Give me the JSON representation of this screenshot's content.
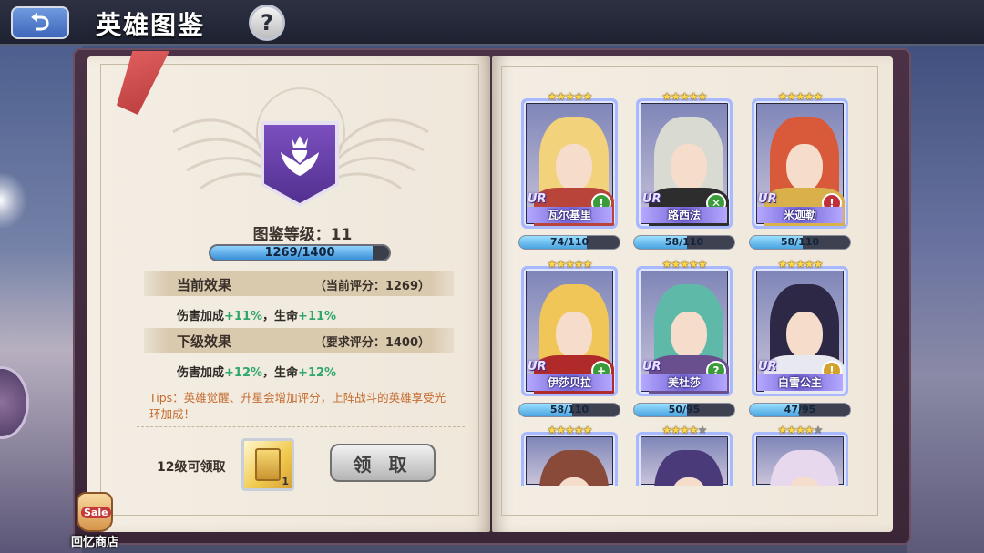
{
  "header": {
    "back_glyph": "⮌",
    "title": "英雄图鉴",
    "help_glyph": "?"
  },
  "codex": {
    "level_text": "图鉴等级：11",
    "progress_text": "1269/1400",
    "progress_fraction": 0.906,
    "current": {
      "title": "当前效果",
      "note": "（当前评分：1269）",
      "effect_prefix": "伤害加成",
      "effect_value1": "+11%",
      "effect_mid": "，生命",
      "effect_value2": "+11%"
    },
    "next": {
      "title": "下级效果",
      "note": "（要求评分：1400）",
      "effect_prefix": "伤害加成",
      "effect_value1": "+12%",
      "effect_mid": "，生命",
      "effect_value2": "+12%"
    },
    "tips": "Tips：英雄觉醒、升星会增加评分，上阵战斗的英雄享受光环加成！",
    "reward_label": "12级可领取",
    "reward_count": "1",
    "claim_button": "领 取"
  },
  "shop": {
    "sale": "Sale",
    "label": "回忆商店"
  },
  "heroes": [
    {
      "name": "瓦尔基里",
      "rarity": "UR",
      "stars": 5,
      "class_glyph": "!",
      "class_color": "#3a9b3a",
      "score": "74/110",
      "score_fraction": 0.673,
      "hair": "#f2d27a",
      "outfit": "#b8443a"
    },
    {
      "name": "路西法",
      "rarity": "UR",
      "stars": 5,
      "class_glyph": "✕",
      "class_color": "#3a9b3a",
      "score": "58/110",
      "score_fraction": 0.527,
      "hair": "#d9dbd2",
      "outfit": "#2d2d2d"
    },
    {
      "name": "米迦勒",
      "rarity": "UR",
      "stars": 5,
      "class_glyph": "!",
      "class_color": "#c0303a",
      "score": "58/110",
      "score_fraction": 0.527,
      "hair": "#d95a3a",
      "outfit": "#d9b04a"
    },
    {
      "name": "伊莎贝拉",
      "rarity": "UR",
      "stars": 5,
      "class_glyph": "+",
      "class_color": "#3a9b3a",
      "score": "58/110",
      "score_fraction": 0.527,
      "hair": "#f0c658",
      "outfit": "#b02a2a"
    },
    {
      "name": "美杜莎",
      "rarity": "UR",
      "stars": 5,
      "class_glyph": "?",
      "class_color": "#3a9b3a",
      "score": "50/95",
      "score_fraction": 0.526,
      "hair": "#5fb9a8",
      "outfit": "#6a4f8e"
    },
    {
      "name": "白雪公主",
      "rarity": "UR",
      "stars": 5,
      "class_glyph": "!",
      "class_color": "#d4a12a",
      "score": "47/95",
      "score_fraction": 0.495,
      "hair": "#2c2846",
      "outfit": "#e8e8f0"
    },
    {
      "name": "",
      "rarity": "",
      "stars": 5,
      "class_glyph": "",
      "class_color": "",
      "score": "",
      "score_fraction": 0,
      "hair": "#8a4a3a",
      "outfit": "#7a2a2a"
    },
    {
      "name": "",
      "rarity": "",
      "stars": 4,
      "class_glyph": "",
      "class_color": "",
      "score": "",
      "score_fraction": 0,
      "hair": "#4a3a7a",
      "outfit": "#3a2a5a"
    },
    {
      "name": "",
      "rarity": "",
      "stars": 4,
      "class_glyph": "",
      "class_color": "",
      "score": "",
      "score_fraction": 0,
      "hair": "#e8d8ee",
      "outfit": "#8a4a8a"
    }
  ]
}
